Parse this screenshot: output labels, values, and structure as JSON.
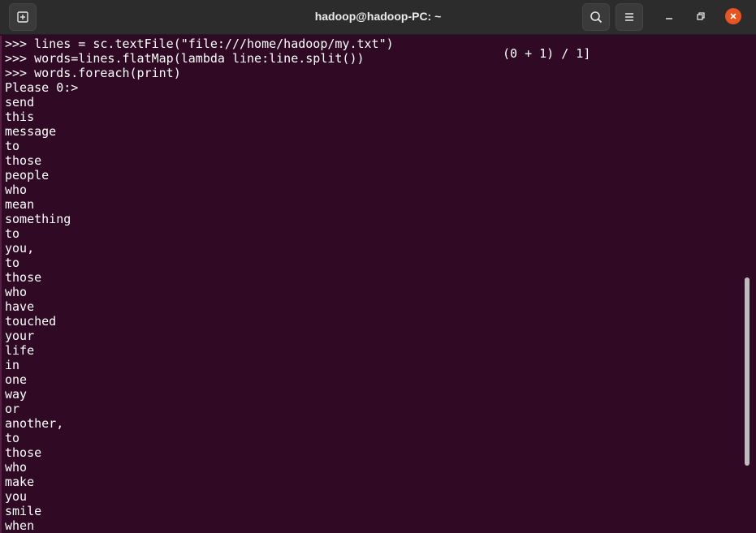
{
  "window": {
    "title": "hadoop@hadoop-PC: ~"
  },
  "toolbar": {
    "new_tab_icon": "new-tab-icon",
    "search_icon": "search-icon",
    "menu_icon": "hamburger-menu-icon"
  },
  "controls": {
    "minimize_icon": "minimize-icon",
    "maximize_icon": "restore-icon",
    "close_icon": "close-icon",
    "close_color": "#e95420"
  },
  "terminal": {
    "background": "#300a24",
    "lines": [
      ">>> lines = sc.textFile(\"file:///home/hadoop/my.txt\")",
      ">>> words=lines.flatMap(lambda line:line.split())",
      ">>> words.foreach(print)",
      "Please 0:>",
      "send",
      "this",
      "message",
      "to",
      "those",
      "people",
      "who",
      "mean",
      "something",
      "to",
      "you,",
      "to",
      "those",
      "who",
      "have",
      "touched",
      "your",
      "life",
      "in",
      "one",
      "way",
      "or",
      "another,",
      "to",
      "those",
      "who",
      "make",
      "you",
      "smile",
      "when"
    ],
    "progress": "(0 + 1) / 1]"
  }
}
